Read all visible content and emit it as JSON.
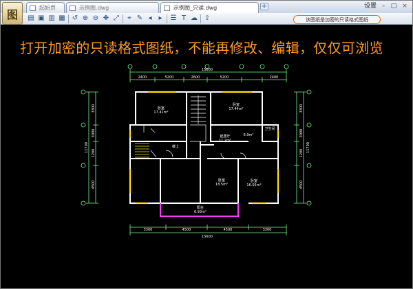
{
  "app": {
    "logo_glyph": "图",
    "tabs": [
      {
        "label": "起始页",
        "active": false
      },
      {
        "label": "示例图.dwg",
        "active": false
      },
      {
        "label": "示例图_只读.dwg",
        "active": true
      }
    ],
    "window_controls": {
      "menu": "设置",
      "minimize": "–",
      "maximize": "□",
      "close": "×"
    },
    "mode_badge": "该图纸是加密的只读格式图纸",
    "toolbar_icons": [
      "open-icon",
      "save-icon",
      "print-icon",
      "export-icon",
      "undo-icon",
      "zoom-in-icon",
      "zoom-out-icon",
      "pan-icon",
      "fit-icon",
      "measure-icon",
      "pen-icon",
      "back-icon",
      "forward-icon",
      "layer-icon",
      "text-icon",
      "cloud-icon",
      "share-icon"
    ]
  },
  "banner": "打开加密的只读格式图纸，不能再修改、编辑，仅仅可浏览",
  "drawing": {
    "top_total": "15600",
    "top_dims": [
      "2400",
      "5200",
      "2600",
      "5200",
      "2400"
    ],
    "bottom_dims": [
      "3300",
      "4500",
      "4500",
      "3300"
    ],
    "bottom_total": "15600",
    "left_dims": [
      "3300",
      "3000",
      "1200",
      "4500"
    ],
    "left_total": "11700",
    "right_dims": [
      "3300",
      "3000",
      "1200",
      "4500"
    ],
    "right_total": "11700",
    "rooms": [
      {
        "name": "卧室",
        "area": "17.41m²"
      },
      {
        "name": "卧室",
        "area": "17.44m²"
      },
      {
        "name": "卫生间",
        "area": ""
      },
      {
        "name": "起居厅",
        "area": "11.2m²"
      },
      {
        "name": "厨房",
        "area": "6.9m²"
      },
      {
        "name": "楼上",
        "area": ""
      },
      {
        "name": "卧室",
        "area": "18.5m²"
      },
      {
        "name": "卧室",
        "area": "16.05m²"
      },
      {
        "name": "阳台",
        "area": "6.93m²"
      }
    ],
    "colors": {
      "wall": "#ffffff",
      "door": "#ffe600",
      "balcony": "#ff39ff",
      "dim": "#7dfc8f",
      "text": "#ffffff"
    }
  }
}
